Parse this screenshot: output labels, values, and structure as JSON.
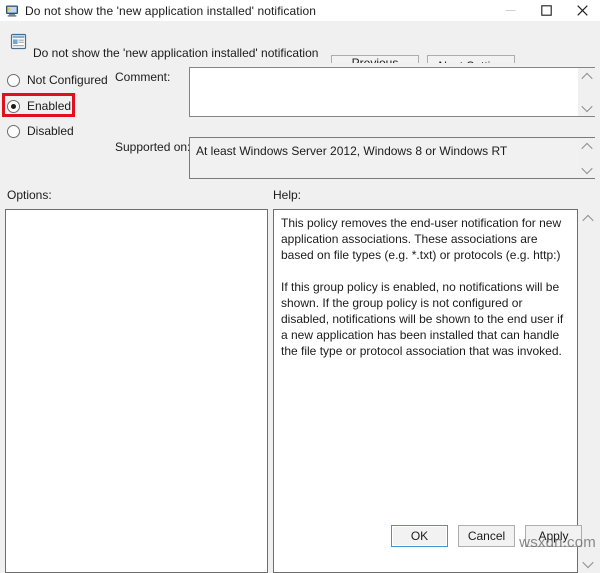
{
  "window": {
    "title": "Do not show the 'new application installed' notification",
    "title_icon": "policy-computer-icon",
    "controls": {
      "minimize": "minimize-icon",
      "maximize": "maximize-icon",
      "close": "close-icon"
    }
  },
  "header": {
    "icon": "policy-setting-icon",
    "title": "Do not show the 'new application installed' notification",
    "previous_setting": "Previous Setting",
    "next_setting": "Next Setting"
  },
  "state": {
    "options": [
      "Not Configured",
      "Enabled",
      "Disabled"
    ],
    "selected": "Enabled",
    "highlight_color": "#e01020"
  },
  "fields": {
    "comment_label": "Comment:",
    "comment_value": "",
    "supported_label": "Supported on:",
    "supported_value": "At least Windows Server 2012, Windows 8 or Windows RT"
  },
  "panels": {
    "options_label": "Options:",
    "options_content": "",
    "help_label": "Help:",
    "help_paragraphs": [
      "This policy removes the end-user notification for new application associations. These associations are based on file types (e.g. *.txt) or protocols (e.g. http:)",
      "If this group policy is enabled, no notifications will be shown. If the group policy is not configured or disabled, notifications will be shown to the end user if a new application has been installed that can handle the file type or protocol association that was invoked."
    ]
  },
  "footer": {
    "ok": "OK",
    "cancel": "Cancel",
    "apply": "Apply"
  },
  "watermark": "wsxdn.com"
}
